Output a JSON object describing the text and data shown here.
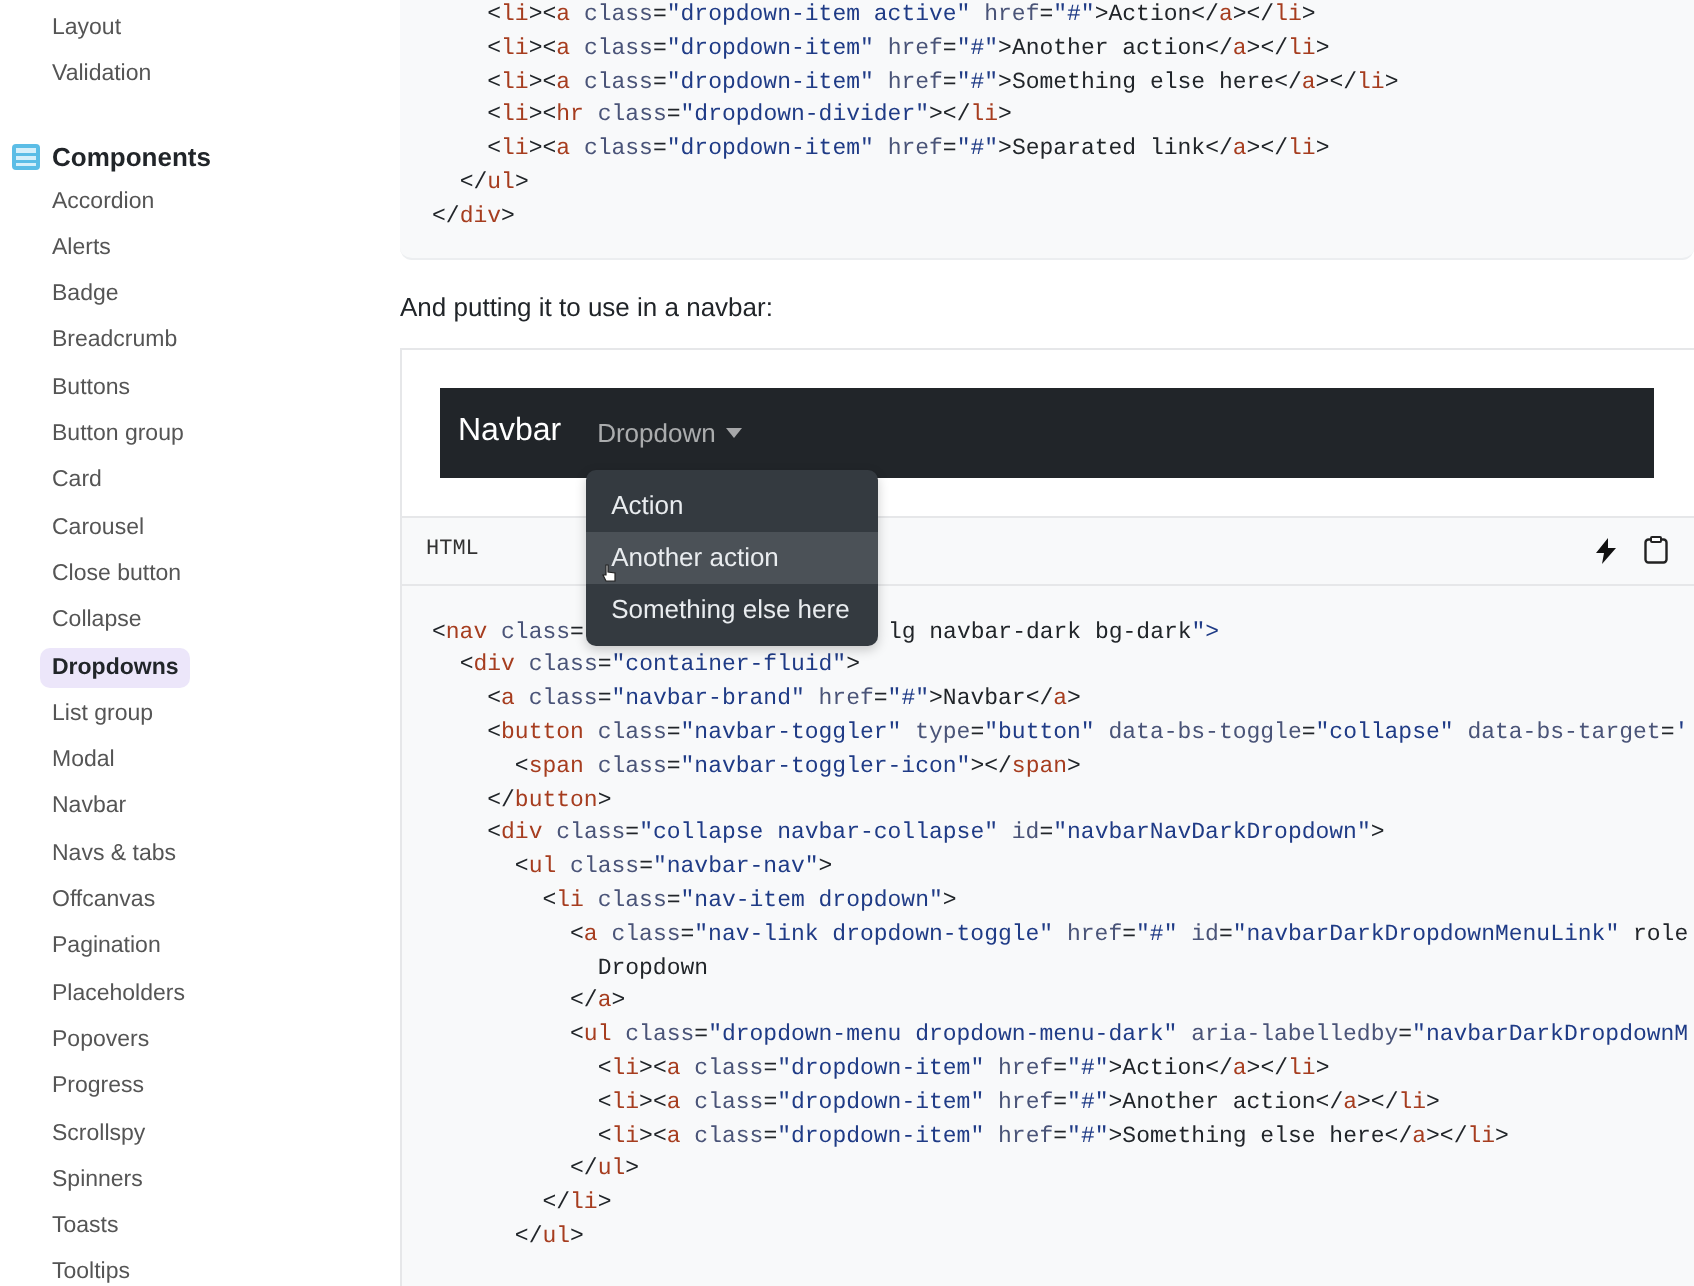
{
  "sidebar": {
    "groups": [
      {
        "items": [
          {
            "label": "Layout",
            "selected": false
          },
          {
            "label": "Validation",
            "selected": false
          }
        ]
      },
      {
        "title": "Components",
        "items": [
          {
            "label": "Accordion",
            "selected": false
          },
          {
            "label": "Alerts",
            "selected": false
          },
          {
            "label": "Badge",
            "selected": false
          },
          {
            "label": "Breadcrumb",
            "selected": false
          },
          {
            "label": "Buttons",
            "selected": false
          },
          {
            "label": "Button group",
            "selected": false
          },
          {
            "label": "Card",
            "selected": false
          },
          {
            "label": "Carousel",
            "selected": false
          },
          {
            "label": "Close button",
            "selected": false
          },
          {
            "label": "Collapse",
            "selected": false
          },
          {
            "label": "Dropdowns",
            "selected": true
          },
          {
            "label": "List group",
            "selected": false
          },
          {
            "label": "Modal",
            "selected": false
          },
          {
            "label": "Navbar",
            "selected": false
          },
          {
            "label": "Navs & tabs",
            "selected": false
          },
          {
            "label": "Offcanvas",
            "selected": false
          },
          {
            "label": "Pagination",
            "selected": false
          },
          {
            "label": "Placeholders",
            "selected": false
          },
          {
            "label": "Popovers",
            "selected": false
          },
          {
            "label": "Progress",
            "selected": false
          },
          {
            "label": "Scrollspy",
            "selected": false
          },
          {
            "label": "Spinners",
            "selected": false
          },
          {
            "label": "Toasts",
            "selected": false
          },
          {
            "label": "Tooltips",
            "selected": false
          }
        ]
      }
    ]
  },
  "top_code": {
    "lines": [
      "    <li><a class=\"dropdown-item active\" href=\"#\">Action</a></li>",
      "    <li><a class=\"dropdown-item\" href=\"#\">Another action</a></li>",
      "    <li><a class=\"dropdown-item\" href=\"#\">Something else here</a></li>",
      "    <li><hr class=\"dropdown-divider\"></li>",
      "    <li><a class=\"dropdown-item\" href=\"#\">Separated link</a></li>",
      "  </ul>",
      "</div>"
    ]
  },
  "paragraph": "And putting it to use in a navbar:",
  "example": {
    "navbar": {
      "brand": "Navbar",
      "dropdown": {
        "label": "Dropdown",
        "expanded": true,
        "menu": [
          {
            "label": "Action",
            "highlighted": false
          },
          {
            "label": "Another action",
            "highlighted": true
          },
          {
            "label": "Something else here",
            "highlighted": false
          }
        ]
      }
    }
  },
  "code_header": {
    "label": "HTML"
  },
  "code": {
    "lines": [
      [
        "<nav class=",
        "lg navbar-dark bg-dark\">"
      ],
      "  <div class=\"container-fluid\">",
      "    <a class=\"navbar-brand\" href=\"#\">Navbar</a>",
      "    <button class=\"navbar-toggler\" type=\"button\" data-bs-toggle=\"collapse\" data-bs-target='",
      "      <span class=\"navbar-toggler-icon\"></span>",
      "    </button>",
      "    <div class=\"collapse navbar-collapse\" id=\"navbarNavDarkDropdown\">",
      "      <ul class=\"navbar-nav\">",
      "        <li class=\"nav-item dropdown\">",
      "          <a class=\"nav-link dropdown-toggle\" href=\"#\" id=\"navbarDarkDropdownMenuLink\" role",
      "            Dropdown",
      "          </a>",
      "          <ul class=\"dropdown-menu dropdown-menu-dark\" aria-labelledby=\"navbarDarkDropdownM",
      "            <li><a class=\"dropdown-item\" href=\"#\">Action</a></li>",
      "            <li><a class=\"dropdown-item\" href=\"#\">Another action</a></li>",
      "            <li><a class=\"dropdown-item\" href=\"#\">Something else here</a></li>",
      "          </ul>",
      "        </li>",
      "      </ul>"
    ]
  }
}
